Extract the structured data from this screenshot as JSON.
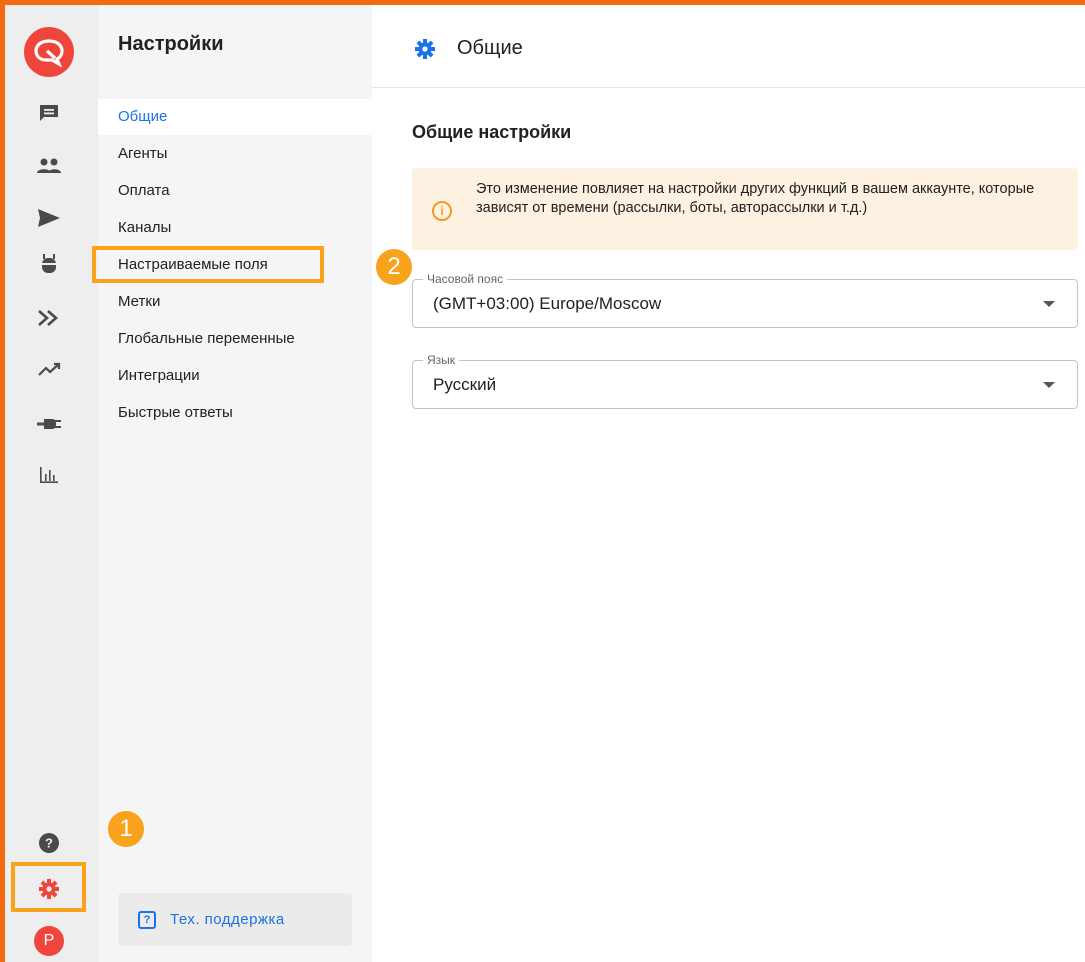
{
  "colors": {
    "accent": "#1a73e8",
    "brand": "#f0453a",
    "highlight": "#f9a21b",
    "frame": "#f26b10"
  },
  "rail": {
    "icons": [
      "chat-icon",
      "agents-icon",
      "send-icon",
      "bot-icon",
      "automation-icon",
      "analytics-icon",
      "integration-plug-icon",
      "reports-icon",
      "help-icon",
      "settings-gear-icon"
    ],
    "avatar_letter": "P"
  },
  "nav": {
    "title": "Настройки",
    "items": [
      {
        "label": "Общие",
        "active": true
      },
      {
        "label": "Агенты"
      },
      {
        "label": "Оплата"
      },
      {
        "label": "Каналы"
      },
      {
        "label": "Настраиваемые поля"
      },
      {
        "label": "Метки"
      },
      {
        "label": "Глобальные переменные"
      },
      {
        "label": "Интеграции"
      },
      {
        "label": "Быстрые ответы"
      }
    ],
    "support_label": "Тех. поддержка"
  },
  "main": {
    "header_title": "Общие",
    "section_title": "Общие настройки",
    "alert_text": "Это изменение повлияет на настройки других функций в вашем аккаунте, которые зависят от времени (рассылки, боты, авторассылки и т.д.)",
    "timezone": {
      "label": "Часовой пояс",
      "value": "(GMT+03:00) Europe/Moscow"
    },
    "language": {
      "label": "Язык",
      "value": "Русский"
    }
  },
  "annotations": {
    "badge1": "1",
    "badge2": "2"
  }
}
